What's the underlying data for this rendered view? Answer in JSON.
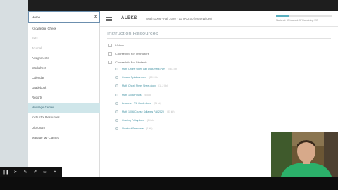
{
  "menu": {
    "search_placeholder": "Home",
    "clear_icon": "close-icon",
    "items": [
      {
        "label": "Knowledge Check",
        "state": "normal"
      },
      {
        "label": "Sets",
        "state": "faint"
      },
      {
        "label": "Journal",
        "state": "faint"
      },
      {
        "label": "Assignments",
        "state": "normal"
      },
      {
        "label": "Worksheet",
        "state": "normal"
      },
      {
        "label": "Calendar",
        "state": "normal"
      },
      {
        "label": "Gradebook",
        "state": "normal"
      },
      {
        "label": "Reports",
        "state": "normal"
      },
      {
        "label": "Message Center",
        "state": "active"
      },
      {
        "label": "Instructor Resources",
        "state": "normal"
      },
      {
        "label": "Dictionary",
        "state": "normal"
      },
      {
        "label": "Manage My Classes",
        "state": "normal"
      }
    ]
  },
  "header": {
    "logo": "ALEKS",
    "course": "Math 1006 - Fall 2020 - 11 TR 2:00 (MuskWilder)",
    "progress_fraction": 0.22,
    "stats": "Mastered: 89   Learned: 37   Remaining: 399"
  },
  "content": {
    "title": "Instruction Resources",
    "checks": [
      {
        "label": "Videos"
      },
      {
        "label": "Course Info For Instructors"
      },
      {
        "label": "Course Info For Students"
      }
    ],
    "resources": [
      {
        "label": "Math Online Open Lab Document.PDF",
        "meta": "(48.4 kb)"
      },
      {
        "label": "Course Syllabus.docx",
        "meta": "(10.5 kb)"
      },
      {
        "label": "Math Cheat Sheet Sheet.docx",
        "meta": "(11.2 kb)"
      },
      {
        "label": "Math 1006 Finals",
        "meta": "(cloud)"
      },
      {
        "label": "Lessons ~ Fill Guide.docx",
        "meta": "(21 kb)"
      },
      {
        "label": "Math 1006 Course Syllabus Fall 2020",
        "meta": "(81 kb)"
      },
      {
        "label": "Grading Policy.docx",
        "meta": "(14 kb)"
      },
      {
        "label": "Shoutout Resource",
        "meta": "(1 kb)"
      }
    ]
  },
  "toolbar": {
    "icons": [
      "pause-icon",
      "pointer-icon",
      "pen-icon",
      "highlighter-icon",
      "screen-icon",
      "close-icon"
    ],
    "glyphs": [
      "❚❚",
      "➤",
      "✎",
      "✐",
      "▭",
      "✕"
    ]
  },
  "colors": {
    "accent": "#3d8fa0",
    "active_item_bg": "#cfe6ea",
    "progress": "#5ab0c0"
  }
}
